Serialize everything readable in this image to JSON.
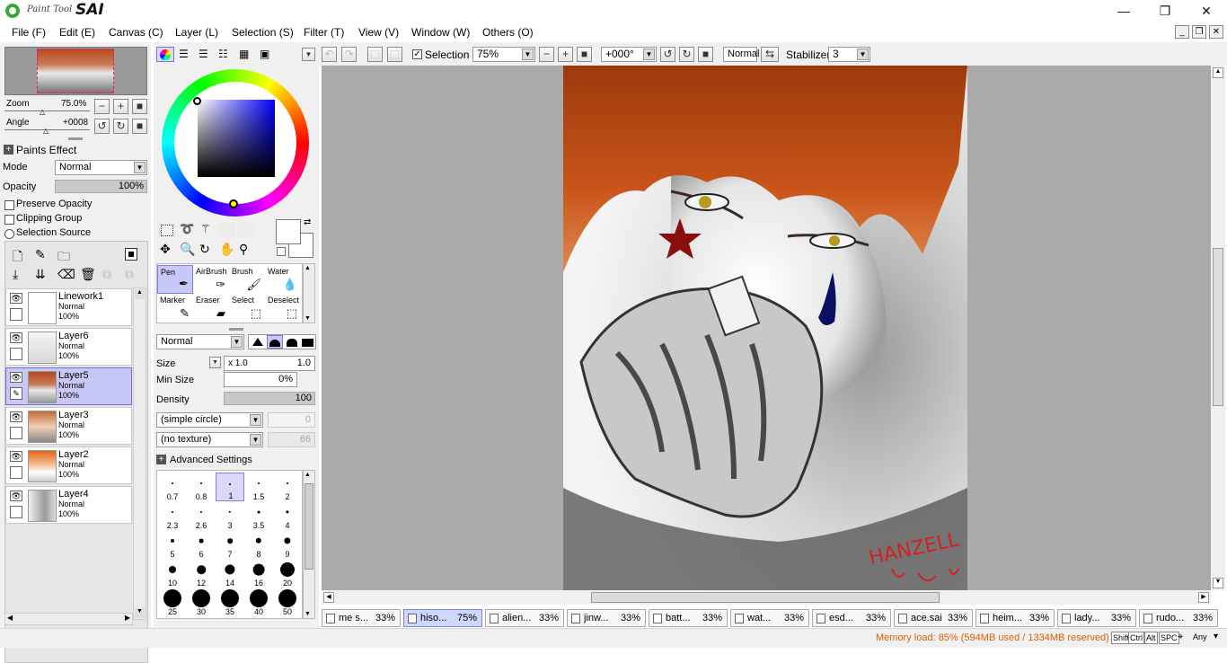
{
  "app": {
    "logo_small": "Paint Tool",
    "logo_big": "SAI"
  },
  "menu": [
    "File (F)",
    "Edit (E)",
    "Canvas (C)",
    "Layer (L)",
    "Selection (S)",
    "Filter (T)",
    "View (V)",
    "Window (W)",
    "Others (O)"
  ],
  "navigator": {
    "zoom_label": "Zoom",
    "zoom_value": "75.0%",
    "angle_label": "Angle",
    "angle_value": "+0008"
  },
  "paints_effect": {
    "title": "Paints Effect",
    "mode_label": "Mode",
    "mode_value": "Normal",
    "opacity_label": "Opacity",
    "opacity_value": "100%",
    "preserve_opacity": "Preserve Opacity",
    "clipping_group": "Clipping Group",
    "selection_source": "Selection Source"
  },
  "layers": [
    {
      "name": "Linework1",
      "mode": "Normal",
      "opacity": "100%",
      "selected": false
    },
    {
      "name": "Layer6",
      "mode": "Normal",
      "opacity": "100%",
      "selected": false
    },
    {
      "name": "Layer5",
      "mode": "Normal",
      "opacity": "100%",
      "selected": true
    },
    {
      "name": "Layer3",
      "mode": "Normal",
      "opacity": "100%",
      "selected": false
    },
    {
      "name": "Layer2",
      "mode": "Normal",
      "opacity": "100%",
      "selected": false
    },
    {
      "name": "Layer4",
      "mode": "Normal",
      "opacity": "100%",
      "selected": false
    }
  ],
  "tools": [
    {
      "label": "Pen",
      "icon": "pen-icon",
      "glyph": "✒"
    },
    {
      "label": "AirBrush",
      "icon": "airbrush-icon",
      "glyph": "✑"
    },
    {
      "label": "Brush",
      "icon": "brush-icon",
      "glyph": "🖌"
    },
    {
      "label": "Water",
      "icon": "water-icon",
      "glyph": "💧"
    },
    {
      "label": "Marker",
      "icon": "marker-icon",
      "glyph": "✎"
    },
    {
      "label": "Eraser",
      "icon": "eraser-icon",
      "glyph": "▰"
    },
    {
      "label": "Select",
      "icon": "select-icon",
      "glyph": "⬚"
    },
    {
      "label": "Deselect",
      "icon": "deselect-icon",
      "glyph": "⬚"
    }
  ],
  "brush": {
    "blend_mode": "Normal",
    "size_label": "Size",
    "size_mult": "x 1.0",
    "size_value": "1.0",
    "min_size_label": "Min Size",
    "min_size_value": "0%",
    "density_label": "Density",
    "density_value": "100",
    "shape": "(simple circle)",
    "shape_value": "0",
    "texture": "(no texture)",
    "texture_value": "66",
    "advanced": "Advanced Settings"
  },
  "brush_sizes": [
    "0.7",
    "0.8",
    "1",
    "1.5",
    "2",
    "2.3",
    "2.6",
    "3",
    "3.5",
    "4",
    "5",
    "6",
    "7",
    "8",
    "9",
    "10",
    "12",
    "14",
    "16",
    "20",
    "25",
    "30",
    "35",
    "40",
    "50"
  ],
  "brush_selected": "1",
  "toolbar": {
    "selection_label": "Selection",
    "zoom_value": "75%",
    "angle_value": "+000°",
    "blend_value": "Normal",
    "stabilizer_label": "Stabilizer",
    "stabilizer_value": "3"
  },
  "artwork": {
    "signature": "HANZELL"
  },
  "tabs": [
    {
      "name": "me s...",
      "pct": "33%",
      "selected": false
    },
    {
      "name": "hiso...",
      "pct": "75%",
      "selected": true
    },
    {
      "name": "alien...",
      "pct": "33%",
      "selected": false
    },
    {
      "name": "jinw...",
      "pct": "33%",
      "selected": false
    },
    {
      "name": "batt...",
      "pct": "33%",
      "selected": false
    },
    {
      "name": "wat...",
      "pct": "33%",
      "selected": false
    },
    {
      "name": "esd...",
      "pct": "33%",
      "selected": false
    },
    {
      "name": "ace.sai",
      "pct": "33%",
      "selected": false
    },
    {
      "name": "heim...",
      "pct": "33%",
      "selected": false
    },
    {
      "name": "lady...",
      "pct": "33%",
      "selected": false
    },
    {
      "name": "rudo...",
      "pct": "33%",
      "selected": false
    }
  ],
  "status": {
    "memory": "Memory load: 85% (594MB used / 1334MB reserved)",
    "keys": [
      "Shift",
      "Ctrl",
      "Alt",
      "SPC",
      "Any"
    ]
  },
  "colors": {
    "accent": "#c8c8f8",
    "status_text": "#e06000",
    "hair": "#b8430e",
    "star": "#8a1010",
    "tear": "#0a1060"
  }
}
